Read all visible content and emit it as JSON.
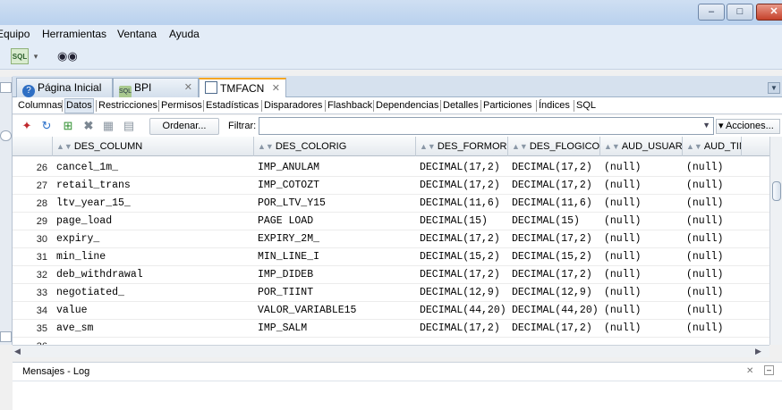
{
  "menu": [
    "Equipo",
    "Herramientas",
    "Ventana",
    "Ayuda"
  ],
  "doc_tabs": [
    {
      "label": "Página Inicial",
      "icon": "help-icon"
    },
    {
      "label": "BPI",
      "icon": "database-connection-icon"
    },
    {
      "label": "TMFACN",
      "icon": "table-icon",
      "active": true
    }
  ],
  "sub_tabs": [
    "Columnas",
    "Datos",
    "Restricciones",
    "Permisos",
    "Estadísticas",
    "Disparadores",
    "Flashback",
    "Dependencias",
    "Detalles",
    "Particiones",
    "Índices",
    "SQL"
  ],
  "active_sub_tab": "Datos",
  "toolbar": {
    "sort_label": "Ordenar...",
    "filter_label": "Filtrar:",
    "filter_value": "",
    "actions_label": "▾ Acciones..."
  },
  "columns": [
    "DES_COLUMN",
    "DES_COLORIG",
    "DES_FORMORIG",
    "DES_FLOGICO",
    "AUD_USUARIO",
    "AUD_TIM"
  ],
  "rows": [
    {
      "n": "26",
      "c": [
        "cancel_1m_",
        "IMP_ANULAM",
        "DECIMAL(17,2)",
        "DECIMAL(17,2)",
        "(null)",
        "(null)"
      ]
    },
    {
      "n": "27",
      "c": [
        "retail_trans",
        "IMP_COTOZT",
        "DECIMAL(17,2)",
        "DECIMAL(17,2)",
        "(null)",
        "(null)"
      ]
    },
    {
      "n": "28",
      "c": [
        "ltv_year_15_",
        "POR_LTV_Y15",
        "DECIMAL(11,6)",
        "DECIMAL(11,6)",
        "(null)",
        "(null)"
      ]
    },
    {
      "n": "29",
      "c": [
        "page_load",
        "PAGE LOAD",
        "DECIMAL(15)",
        "DECIMAL(15)",
        "(null)",
        "(null)"
      ]
    },
    {
      "n": "30",
      "c": [
        "expiry_",
        "EXPIRY_2M_",
        "DECIMAL(17,2)",
        "DECIMAL(17,2)",
        "(null)",
        "(null)"
      ]
    },
    {
      "n": "31",
      "c": [
        "min_line",
        "MIN_LINE_I",
        "DECIMAL(15,2)",
        "DECIMAL(15,2)",
        "(null)",
        "(null)"
      ]
    },
    {
      "n": "32",
      "c": [
        "deb_withdrawal",
        "IMP_DIDEB",
        "DECIMAL(17,2)",
        "DECIMAL(17,2)",
        "(null)",
        "(null)"
      ]
    },
    {
      "n": "33",
      "c": [
        "negotiated_",
        "POR_TIINT",
        "DECIMAL(12,9)",
        "DECIMAL(12,9)",
        "(null)",
        "(null)"
      ]
    },
    {
      "n": "34",
      "c": [
        "value",
        "VALOR_VARIABLE15",
        "DECIMAL(44,20)",
        "DECIMAL(44,20)",
        "(null)",
        "(null)"
      ]
    },
    {
      "n": "35",
      "c": [
        "ave_sm",
        "IMP_SALM",
        "DECIMAL(17,2)",
        "DECIMAL(17,2)",
        "(null)",
        "(null)"
      ]
    },
    {
      "n": "36",
      "c": [
        "",
        "",
        "",
        "",
        "",
        ""
      ]
    }
  ],
  "log_title": "Mensajes - Log"
}
